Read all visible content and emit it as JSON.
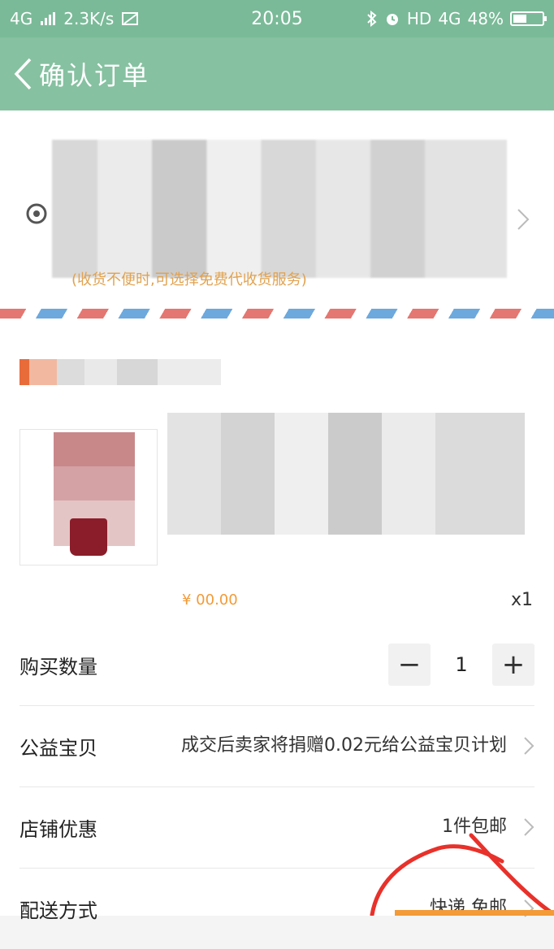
{
  "status_bar": {
    "network": "4G",
    "speed": "2.3K/s",
    "time": "20:05",
    "hd": "HD",
    "net2": "4G",
    "battery": "48%",
    "battery_level": 0.48
  },
  "nav": {
    "title": "确认订单"
  },
  "address": {
    "note": "(收货不便时,可选择免费代收货服务)"
  },
  "goods": {
    "price": "¥ 00.00",
    "quantity": "x1"
  },
  "rows": {
    "quantity": {
      "label": "购买数量",
      "value": "1",
      "minus": "−",
      "plus": "+"
    },
    "charity": {
      "label": "公益宝贝",
      "value": "成交后卖家将捐赠0.02元给公益宝贝计划"
    },
    "shop_discount": {
      "label": "店铺优惠",
      "value": "1件包邮"
    },
    "delivery": {
      "label": "配送方式",
      "value": "快递 免邮"
    }
  },
  "colors": {
    "status_bar": "#7aba98",
    "nav_bar": "#86c1a1",
    "accent": "#f29b38",
    "annotation": "#e8312a"
  }
}
